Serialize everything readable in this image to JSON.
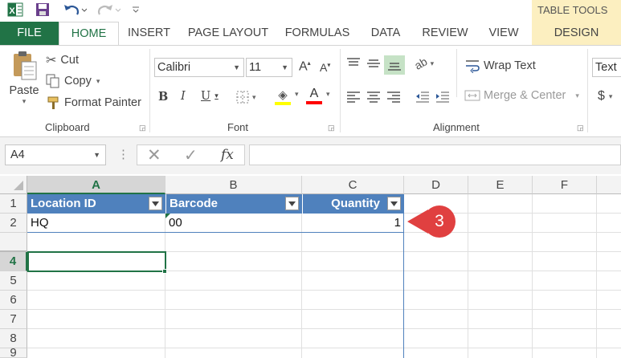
{
  "qat": {
    "icons": [
      "excel-logo-icon",
      "save-icon",
      "undo-icon",
      "redo-icon",
      "customize-qat-icon"
    ]
  },
  "contextual": {
    "group_label": "TABLE TOOLS"
  },
  "tabs": {
    "file": "FILE",
    "home": "HOME",
    "insert": "INSERT",
    "page_layout": "PAGE LAYOUT",
    "formulas": "FORMULAS",
    "data": "DATA",
    "review": "REVIEW",
    "view": "VIEW",
    "design": "DESIGN"
  },
  "clipboard": {
    "paste": "Paste",
    "cut": "Cut",
    "copy": "Copy",
    "format_painter": "Format Painter",
    "label": "Clipboard"
  },
  "font": {
    "name": "Calibri",
    "size": "11",
    "label": "Font",
    "bold": "B",
    "italic": "I",
    "underline": "U",
    "highlight_color": "#ffff00",
    "font_color": "#ff0000"
  },
  "alignment": {
    "wrap_text": "Wrap Text",
    "merge_center": "Merge & Center",
    "label": "Alignment"
  },
  "number": {
    "format": "Text",
    "currency_symbol": "$"
  },
  "formula_bar": {
    "name_box": "A4",
    "fx": "fx",
    "value": ""
  },
  "sheet": {
    "columns": [
      "A",
      "B",
      "C",
      "D",
      "E",
      "F"
    ],
    "rows": [
      "1",
      "2",
      "4",
      "5",
      "6",
      "7",
      "8",
      "9"
    ],
    "headers": [
      "Location ID",
      "Barcode",
      "Quantity"
    ],
    "row2": {
      "location": "HQ",
      "barcode": "00",
      "quantity": "1"
    },
    "accent": "#4f81bd",
    "active_cell": "A4"
  },
  "callout": {
    "number": "3",
    "color": "#e04040"
  }
}
